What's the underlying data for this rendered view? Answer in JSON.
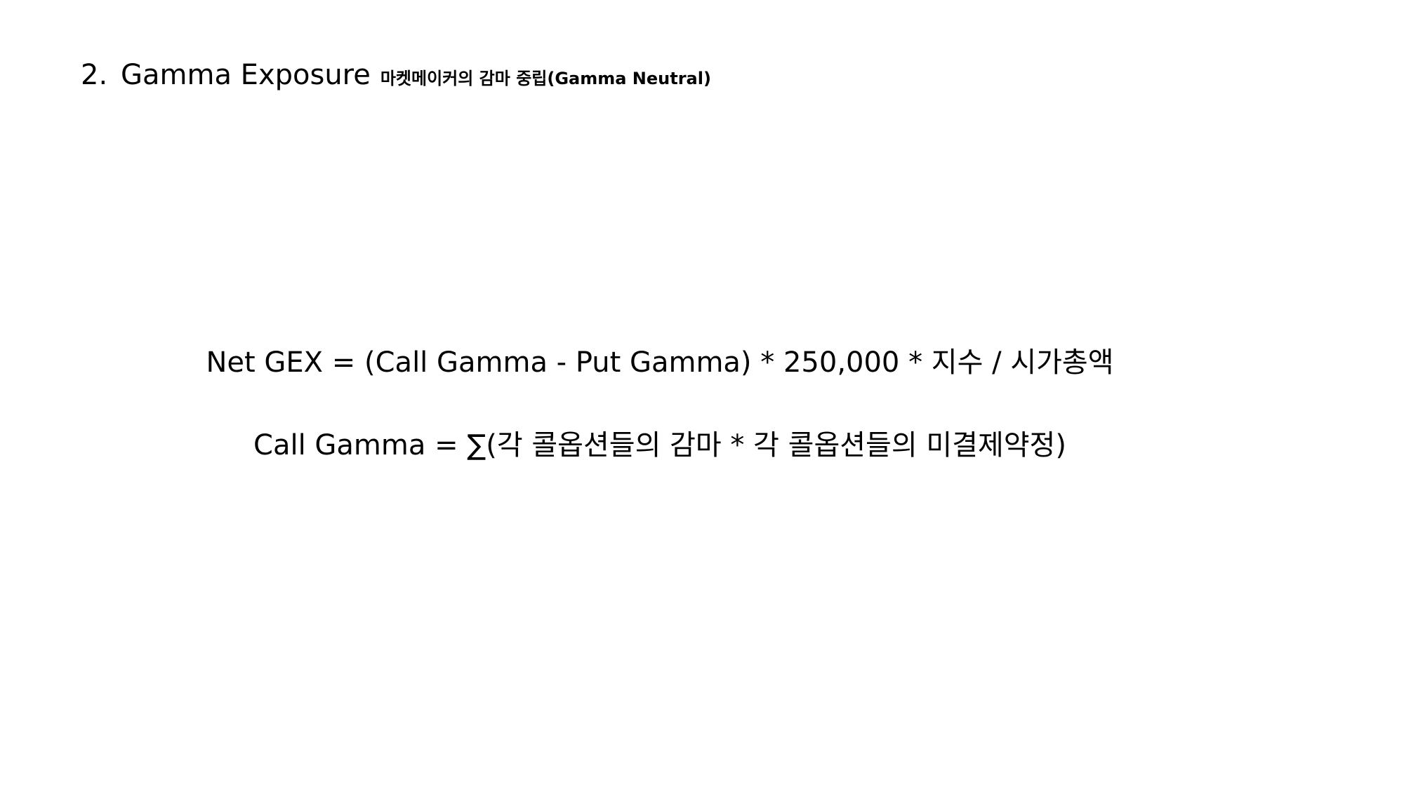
{
  "heading": {
    "number": "2.",
    "title": "Gamma Exposure",
    "subtitle": "마켓메이커의 감마 중립(Gamma Neutral)"
  },
  "formulas": [
    "Net GEX = (Call Gamma - Put Gamma) * 250,000 * 지수 / 시가총액",
    "Call Gamma = ∑(각 콜옵션들의 감마 * 각 콜옵션들의 미결제약정)"
  ]
}
